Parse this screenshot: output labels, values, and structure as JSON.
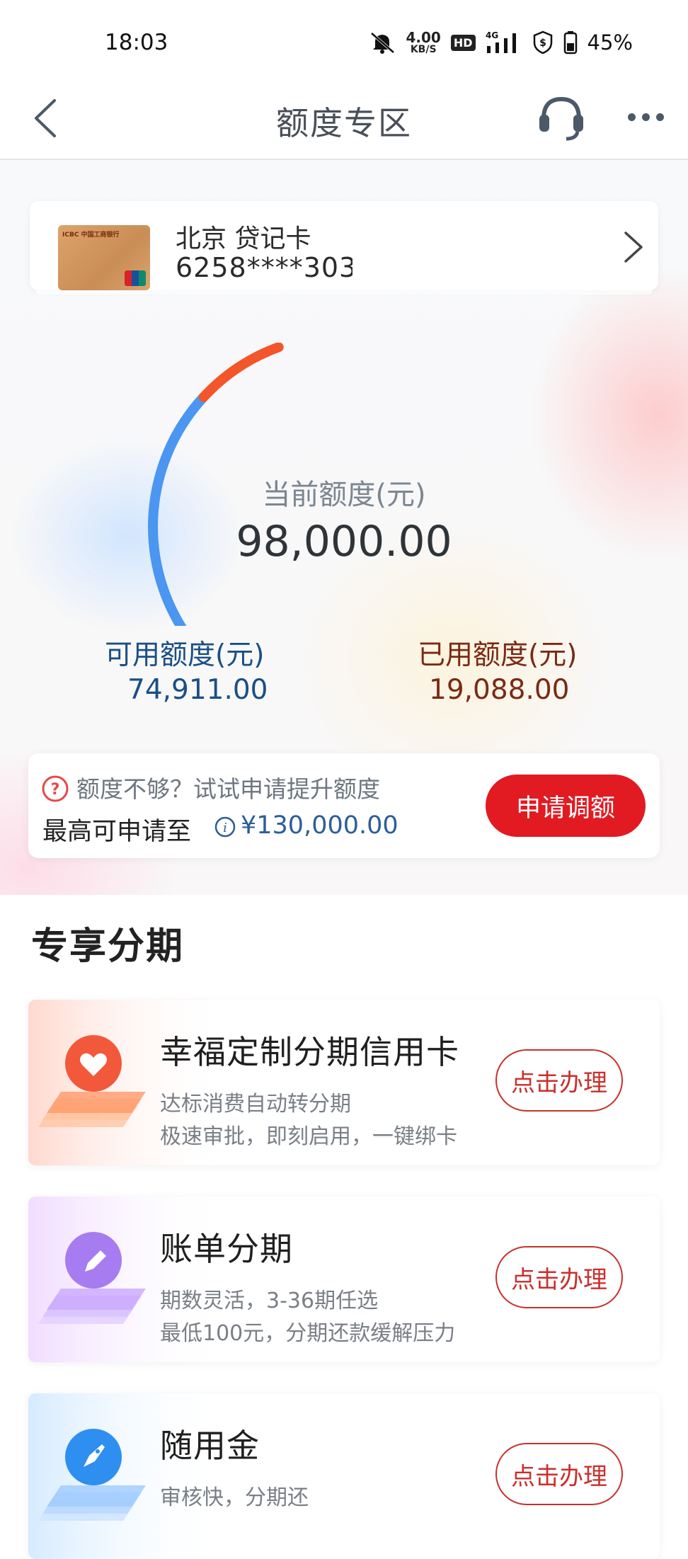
{
  "status_bar": {
    "time": "18:03",
    "net_speed_value": "4.00",
    "net_speed_unit": "KB/S",
    "hd_label": "HD",
    "network_label": "4G",
    "battery_percent": "45%"
  },
  "header": {
    "title": "额度专区"
  },
  "card": {
    "name": "北京 贷记卡",
    "number": "6258****303",
    "card_logo_text": "ICBC 中国工商银行"
  },
  "gauge": {
    "current_label": "当前额度(元)",
    "current_value": "98,000.00",
    "available_label": "可用额度(元)",
    "available_value": "74,911.00",
    "used_label": "已用额度(元)",
    "used_value": "19,088.00",
    "total": 98000,
    "used": 19088,
    "available_color": "#4a96f0",
    "used_color": "#f2562a"
  },
  "raise": {
    "tip": "额度不够？试试申请提升额度",
    "max_label": "最高可申请至",
    "max_value": "¥130,000.00",
    "button_label": "申请调额"
  },
  "section": {
    "title": "专享分期"
  },
  "items": [
    {
      "title": "幸福定制分期信用卡",
      "sub1": "达标消费自动转分期",
      "sub2": "极速审批，即刻启用，一键绑卡",
      "button_label": "点击办理",
      "icon": "heart-icon",
      "accent": "#f2583a"
    },
    {
      "title": "账单分期",
      "sub1": "期数灵活，3-36期任选",
      "sub2": "最低100元，分期还款缓解压力",
      "button_label": "点击办理",
      "icon": "pen-icon",
      "accent": "#a67cf0"
    },
    {
      "title": "随用金",
      "sub1": "审核快，分期还",
      "sub2": "",
      "button_label": "点击办理",
      "icon": "rocket-icon",
      "accent": "#2e8ff0"
    }
  ]
}
